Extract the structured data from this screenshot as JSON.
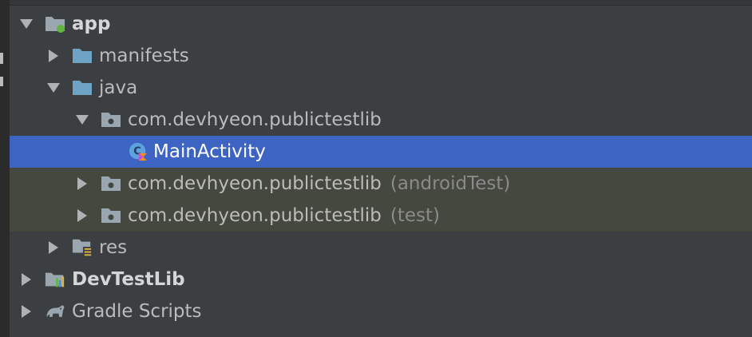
{
  "tree": {
    "items": [
      {
        "label": "app",
        "icon": "module-folder-icon",
        "expanded": true
      },
      {
        "label": "manifests",
        "icon": "folder-icon",
        "expanded": false
      },
      {
        "label": "java",
        "icon": "folder-icon",
        "expanded": true
      },
      {
        "label": "com.devhyeon.publictestlib",
        "icon": "package-icon",
        "expanded": true
      },
      {
        "label": "MainActivity",
        "icon": "kotlin-class-icon",
        "selected": true
      },
      {
        "label": "com.devhyeon.publictestlib",
        "suffix": "(androidTest)",
        "icon": "package-icon",
        "expanded": false
      },
      {
        "label": "com.devhyeon.publictestlib",
        "suffix": "(test)",
        "icon": "package-icon",
        "expanded": false
      },
      {
        "label": "res",
        "icon": "resource-folder-icon",
        "expanded": false
      },
      {
        "label": "DevTestLib",
        "icon": "project-module-icon",
        "expanded": false
      },
      {
        "label": "Gradle Scripts",
        "icon": "gradle-elephant-icon",
        "expanded": false
      }
    ]
  },
  "colors": {
    "background": "#3c3f41",
    "selection": "#3d64c2",
    "test_source_highlight": "#45483e",
    "folder_blue": "#6fa3c6",
    "text": "#bbbbbb"
  }
}
